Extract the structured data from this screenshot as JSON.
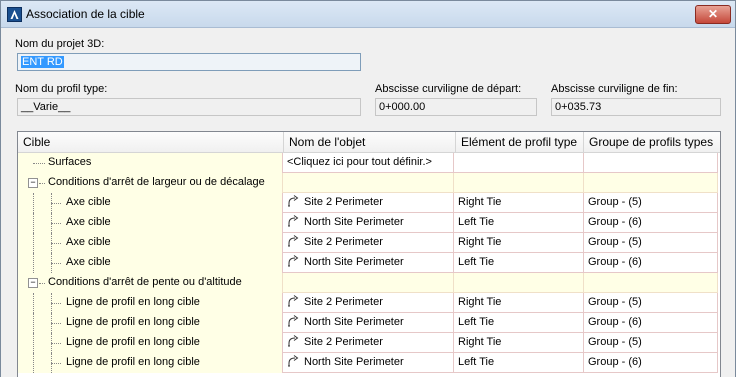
{
  "window": {
    "title": "Association de la cible",
    "close_glyph": "✕"
  },
  "project": {
    "label": "Nom du projet 3D:",
    "value": "ENT RD"
  },
  "profile": {
    "label": "Nom du profil type:",
    "value": "__Varie__"
  },
  "start": {
    "label": "Abscisse curviligne de départ:",
    "value": "0+000.00"
  },
  "end": {
    "label": "Abscisse curviligne de fin:",
    "value": "0+035.73"
  },
  "grid": {
    "headers": [
      "Cible",
      "Nom de l'objet",
      "Elément de profil type",
      "Groupe de profils types"
    ],
    "rows": [
      {
        "kind": "leaf0",
        "target": "Surfaces",
        "object": "<Cliquez ici pour tout définir.>",
        "element": "",
        "group": ""
      },
      {
        "kind": "cat",
        "target": "Conditions d'arrêt de largeur ou de décalage",
        "object": "",
        "element": "",
        "group": ""
      },
      {
        "kind": "child",
        "target": "Axe cible",
        "object": "Site 2 Perimeter",
        "element": "Right Tie",
        "group": "Group - (5)"
      },
      {
        "kind": "child",
        "target": "Axe cible",
        "object": "North Site Perimeter",
        "element": "Left Tie",
        "group": "Group - (6)"
      },
      {
        "kind": "child",
        "target": "Axe cible",
        "object": "Site 2 Perimeter",
        "element": "Right Tie",
        "group": "Group - (5)"
      },
      {
        "kind": "child",
        "target": "Axe cible",
        "object": "North Site Perimeter",
        "element": "Left Tie",
        "group": "Group - (6)"
      },
      {
        "kind": "cat",
        "target": "Conditions d'arrêt de pente ou d'altitude",
        "object": "",
        "element": "",
        "group": ""
      },
      {
        "kind": "child",
        "target": "Ligne de profil en long cible",
        "object": "Site 2 Perimeter",
        "element": "Right Tie",
        "group": "Group - (5)"
      },
      {
        "kind": "child",
        "target": "Ligne de profil en long cible",
        "object": "North Site Perimeter",
        "element": "Left Tie",
        "group": "Group - (6)"
      },
      {
        "kind": "child",
        "target": "Ligne de profil en long cible",
        "object": "Site 2 Perimeter",
        "element": "Right Tie",
        "group": "Group - (5)"
      },
      {
        "kind": "child",
        "target": "Ligne de profil en long cible",
        "object": "North Site Perimeter",
        "element": "Left Tie",
        "group": "Group - (6)"
      }
    ]
  },
  "icons": {
    "app": "autocad-icon",
    "link": "link-arrow-icon",
    "expander": "collapse-minus-icon"
  },
  "colors": {
    "target_column": "#ffffe6",
    "selection": "#3399ff",
    "cell_border": "#e6c8c8"
  }
}
